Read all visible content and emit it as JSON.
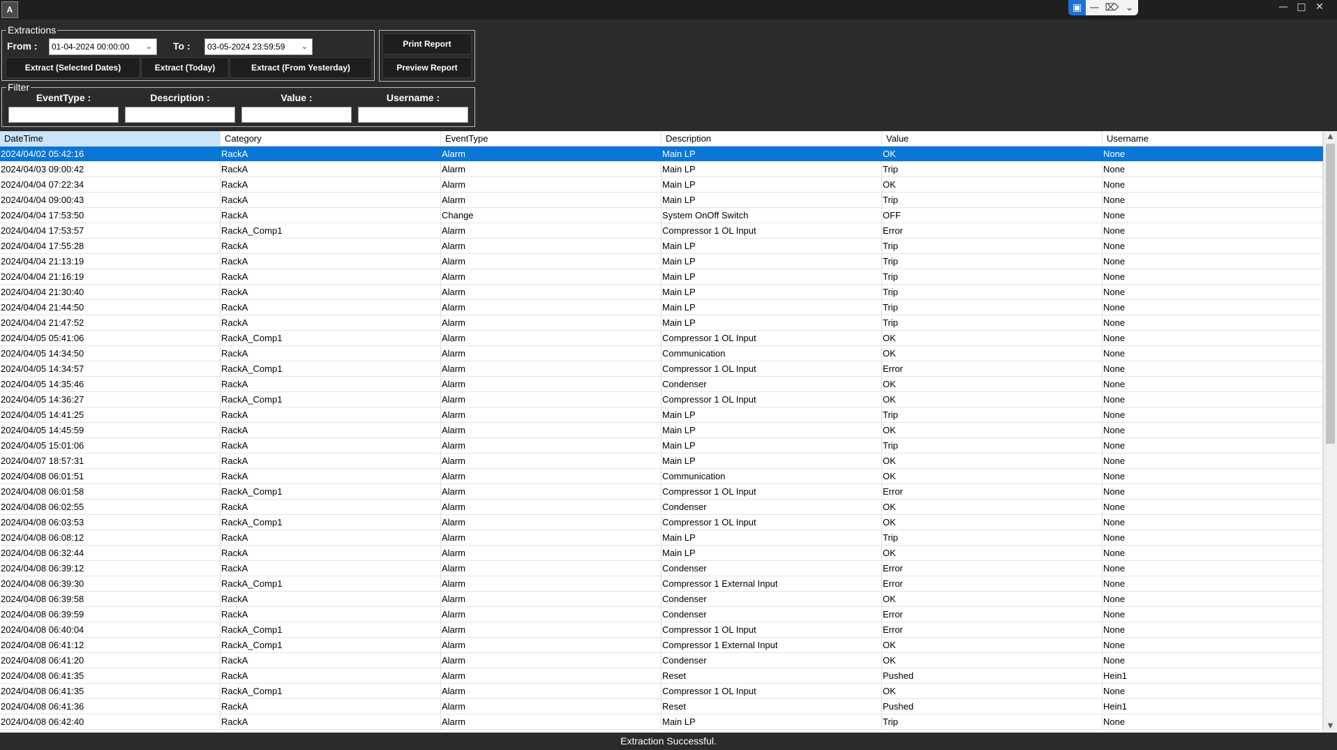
{
  "titlebar": {
    "app_icon_glyph": "A",
    "remote_icons": [
      "remote-session-icon",
      "minimize-icon",
      "shrink-icon",
      "chevron-down-icon"
    ]
  },
  "extractions": {
    "title": "Extractions",
    "from_label": "From :",
    "from_value": "01-04-2024 00:00:00",
    "to_label": "To :",
    "to_value": "03-05-2024 23:59:59",
    "btn_selected": "Extract (Selected Dates)",
    "btn_today": "Extract (Today)",
    "btn_yesterday": "Extract (From Yesterday)",
    "btn_print": "Print Report",
    "btn_preview": "Preview Report"
  },
  "filter": {
    "title": "Filter",
    "eventtype_label": "EventType :",
    "description_label": "Description :",
    "value_label": "Value :",
    "username_label": "Username :",
    "eventtype_value": "",
    "description_value": "",
    "value_value": "",
    "username_value": ""
  },
  "grid": {
    "columns": [
      "DateTime",
      "Category",
      "EventType",
      "Description",
      "Value",
      "Username"
    ],
    "rows": [
      [
        "2024/04/02 05:42:16",
        "RackA",
        "Alarm",
        "Main LP",
        "OK",
        "None"
      ],
      [
        "2024/04/03 09:00:42",
        "RackA",
        "Alarm",
        "Main LP",
        "Trip",
        "None"
      ],
      [
        "2024/04/04 07:22:34",
        "RackA",
        "Alarm",
        "Main LP",
        "OK",
        "None"
      ],
      [
        "2024/04/04 09:00:43",
        "RackA",
        "Alarm",
        "Main LP",
        "Trip",
        "None"
      ],
      [
        "2024/04/04 17:53:50",
        "RackA",
        "Change",
        "System OnOff Switch",
        "OFF",
        "None"
      ],
      [
        "2024/04/04 17:53:57",
        "RackA_Comp1",
        "Alarm",
        "Compressor 1 OL Input",
        "Error",
        "None"
      ],
      [
        "2024/04/04 17:55:28",
        "RackA",
        "Alarm",
        "Main LP",
        "Trip",
        "None"
      ],
      [
        "2024/04/04 21:13:19",
        "RackA",
        "Alarm",
        "Main LP",
        "Trip",
        "None"
      ],
      [
        "2024/04/04 21:16:19",
        "RackA",
        "Alarm",
        "Main LP",
        "Trip",
        "None"
      ],
      [
        "2024/04/04 21:30:40",
        "RackA",
        "Alarm",
        "Main LP",
        "Trip",
        "None"
      ],
      [
        "2024/04/04 21:44:50",
        "RackA",
        "Alarm",
        "Main LP",
        "Trip",
        "None"
      ],
      [
        "2024/04/04 21:47:52",
        "RackA",
        "Alarm",
        "Main LP",
        "Trip",
        "None"
      ],
      [
        "2024/04/05 05:41:06",
        "RackA_Comp1",
        "Alarm",
        "Compressor 1 OL Input",
        "OK",
        "None"
      ],
      [
        "2024/04/05 14:34:50",
        "RackA",
        "Alarm",
        "Communication",
        "OK",
        "None"
      ],
      [
        "2024/04/05 14:34:57",
        "RackA_Comp1",
        "Alarm",
        "Compressor 1 OL Input",
        "Error",
        "None"
      ],
      [
        "2024/04/05 14:35:46",
        "RackA",
        "Alarm",
        "Condenser",
        "OK",
        "None"
      ],
      [
        "2024/04/05 14:36:27",
        "RackA_Comp1",
        "Alarm",
        "Compressor 1 OL Input",
        "OK",
        "None"
      ],
      [
        "2024/04/05 14:41:25",
        "RackA",
        "Alarm",
        "Main LP",
        "Trip",
        "None"
      ],
      [
        "2024/04/05 14:45:59",
        "RackA",
        "Alarm",
        "Main LP",
        "OK",
        "None"
      ],
      [
        "2024/04/05 15:01:06",
        "RackA",
        "Alarm",
        "Main LP",
        "Trip",
        "None"
      ],
      [
        "2024/04/07 18:57:31",
        "RackA",
        "Alarm",
        "Main LP",
        "OK",
        "None"
      ],
      [
        "2024/04/08 06:01:51",
        "RackA",
        "Alarm",
        "Communication",
        "OK",
        "None"
      ],
      [
        "2024/04/08 06:01:58",
        "RackA_Comp1",
        "Alarm",
        "Compressor 1 OL Input",
        "Error",
        "None"
      ],
      [
        "2024/04/08 06:02:55",
        "RackA",
        "Alarm",
        "Condenser",
        "OK",
        "None"
      ],
      [
        "2024/04/08 06:03:53",
        "RackA_Comp1",
        "Alarm",
        "Compressor 1 OL Input",
        "OK",
        "None"
      ],
      [
        "2024/04/08 06:08:12",
        "RackA",
        "Alarm",
        "Main LP",
        "Trip",
        "None"
      ],
      [
        "2024/04/08 06:32:44",
        "RackA",
        "Alarm",
        "Main LP",
        "OK",
        "None"
      ],
      [
        "2024/04/08 06:39:12",
        "RackA",
        "Alarm",
        "Condenser",
        "Error",
        "None"
      ],
      [
        "2024/04/08 06:39:30",
        "RackA_Comp1",
        "Alarm",
        "Compressor 1 External Input",
        "Error",
        "None"
      ],
      [
        "2024/04/08 06:39:58",
        "RackA",
        "Alarm",
        "Condenser",
        "OK",
        "None"
      ],
      [
        "2024/04/08 06:39:59",
        "RackA",
        "Alarm",
        "Condenser",
        "Error",
        "None"
      ],
      [
        "2024/04/08 06:40:04",
        "RackA_Comp1",
        "Alarm",
        "Compressor 1 OL Input",
        "Error",
        "None"
      ],
      [
        "2024/04/08 06:41:12",
        "RackA_Comp1",
        "Alarm",
        "Compressor 1 External Input",
        "OK",
        "None"
      ],
      [
        "2024/04/08 06:41:20",
        "RackA",
        "Alarm",
        "Condenser",
        "OK",
        "None"
      ],
      [
        "2024/04/08 06:41:35",
        "RackA",
        "Alarm",
        "Reset",
        "Pushed",
        "Hein1"
      ],
      [
        "2024/04/08 06:41:35",
        "RackA_Comp1",
        "Alarm",
        "Compressor 1 OL Input",
        "OK",
        "None"
      ],
      [
        "2024/04/08 06:41:36",
        "RackA",
        "Alarm",
        "Reset",
        "Pushed",
        "Hein1"
      ],
      [
        "2024/04/08 06:42:40",
        "RackA",
        "Alarm",
        "Main LP",
        "Trip",
        "None"
      ]
    ]
  },
  "status": {
    "message": "Extraction Successful."
  },
  "colors": {
    "background": "#2b2b2b",
    "selected_row": "#0a76d8",
    "header_selected": "#cce4f7"
  }
}
